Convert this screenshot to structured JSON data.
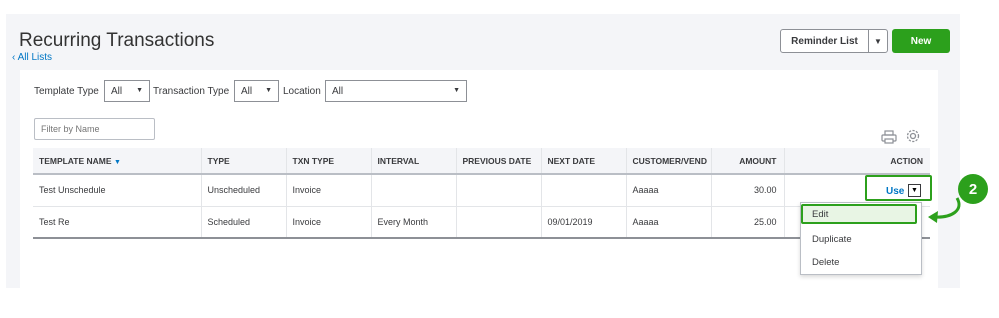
{
  "page": {
    "title": "Recurring Transactions",
    "back_link": "All Lists"
  },
  "toolbar": {
    "reminder_label": "Reminder List",
    "new_label": "New"
  },
  "filters": {
    "template_type_label": "Template Type",
    "template_type_value": "All",
    "transaction_type_label": "Transaction Type",
    "transaction_type_value": "All",
    "location_label": "Location",
    "location_value": "All",
    "search_placeholder": "Filter by Name"
  },
  "table": {
    "headers": [
      "TEMPLATE NAME",
      "TYPE",
      "TXN TYPE",
      "INTERVAL",
      "PREVIOUS DATE",
      "NEXT DATE",
      "CUSTOMER/VEND",
      "AMOUNT",
      "ACTION"
    ],
    "rows": [
      {
        "template_name": "Test Unschedule",
        "type": "Unscheduled",
        "txn_type": "Invoice",
        "interval": "",
        "previous_date": "",
        "next_date": "",
        "customer": "Aaaaa",
        "amount": "30.00",
        "action": "Use"
      },
      {
        "template_name": "Test Re",
        "type": "Scheduled",
        "txn_type": "Invoice",
        "interval": "Every Month",
        "previous_date": "",
        "next_date": "09/01/2019",
        "customer": "Aaaaa",
        "amount": "25.00",
        "action": ""
      }
    ]
  },
  "action_menu": {
    "items": [
      "Edit",
      "Duplicate",
      "Delete"
    ]
  },
  "annotation": {
    "step_number": "2",
    "accent_color": "#2ca01c"
  },
  "colors": {
    "brand_green": "#2ca01c",
    "link_blue": "#0077c5"
  }
}
